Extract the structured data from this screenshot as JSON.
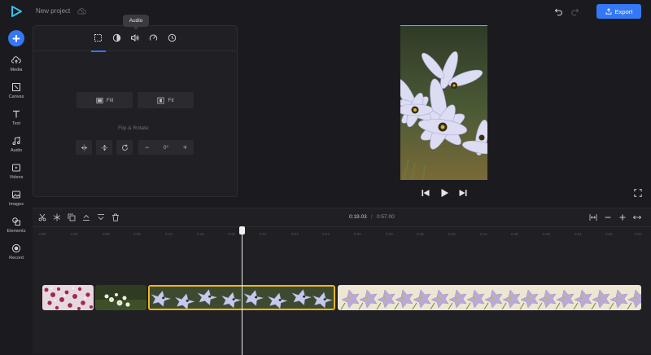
{
  "app": {
    "project_name": "New project",
    "export_label": "Export",
    "brand_color": "#3478f6"
  },
  "sidebar": {
    "items": [
      {
        "label": "Media",
        "icon": "cloud-upload-icon"
      },
      {
        "label": "Canvas",
        "icon": "canvas-icon"
      },
      {
        "label": "Text",
        "icon": "text-icon"
      },
      {
        "label": "Audio",
        "icon": "music-note-icon"
      },
      {
        "label": "Videos",
        "icon": "video-icon"
      },
      {
        "label": "Images",
        "icon": "image-icon"
      },
      {
        "label": "Elements",
        "icon": "shapes-icon"
      },
      {
        "label": "Record",
        "icon": "record-icon"
      }
    ]
  },
  "panel": {
    "tooltip": "Audio",
    "tabs": [
      "crop-icon",
      "contrast-icon",
      "volume-icon",
      "speed-icon",
      "clock-icon"
    ],
    "active_tab": 0,
    "fill_label": "Fill",
    "fit_label": "Fit",
    "flip_rotate_label": "Flip & Rotate",
    "rotation_value": "0°"
  },
  "timeline": {
    "current_time": "0:19.03",
    "separator": "/",
    "total_time": "0:57.00",
    "ticks": [
      "0:00",
      "0:03",
      "0:08",
      "0:09",
      "0:12",
      "0:15",
      "0:18",
      "0:21",
      "0:24",
      "0:27",
      "0:30",
      "0:33",
      "0:36",
      "0:39",
      "0:42",
      "0:45",
      "0:48",
      "0:51",
      "0:54",
      "0:57"
    ],
    "clips": [
      "pink-flowers-clip",
      "white-flowers-clip",
      "blue-flowers-clip",
      "spring-flowers-clip"
    ],
    "selected_clip_color": "#f1b818"
  }
}
